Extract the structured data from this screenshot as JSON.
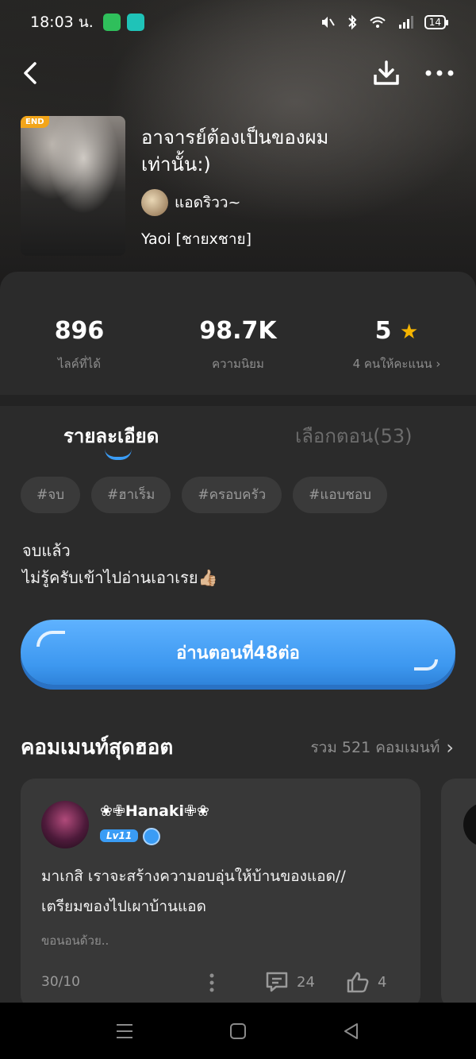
{
  "status_bar": {
    "time": "18:03 น.",
    "battery": "14"
  },
  "book": {
    "end_badge": "END",
    "title": "อาจารย์ต้องเป็นของผมเท่านั้น:)",
    "author": "แอดริวว~",
    "genre": "Yaoi [ชายxชาย]"
  },
  "stats": {
    "likes_value": "896",
    "likes_label": "ไลค์ที่ได้",
    "popularity_value": "98.7K",
    "popularity_label": "ความนิยม",
    "rating_value": "5",
    "rating_label": "4 คนให้คะแนน"
  },
  "tabs": {
    "details": "รายละเอียด",
    "episodes": "เลือกตอน(53)"
  },
  "tags": [
    "#จบ",
    "#ฮาเร็ม",
    "#ครอบครัว",
    "#แอบชอบ"
  ],
  "description": {
    "line1": "จบแล้ว",
    "line2": "ไม่รู้ครับเข้าไปอ่านเอาเรย👍🏼"
  },
  "read_button": "อ่านตอนที่48ต่อ",
  "hot_comments": {
    "title": "คอมเมนท์สุดฮอต",
    "total": "รวม 521 คอมเมนท์"
  },
  "comment": {
    "username": "❀✙Hanaki✙❀",
    "level": "Lv11",
    "text": "มาเกสิ เราจะสร้างความอบอุ่นให้บ้านของแอด//เตรียมของไปเผาบ้านแอด",
    "reply_preview": "ขอนอนด้วย..",
    "date": "30/10",
    "comment_count": "24",
    "like_count": "4"
  },
  "colors": {
    "accent": "#3a9cf5",
    "star": "#f5b400",
    "end_badge": "#f2a51a",
    "sheet_bg": "#2b2b2b",
    "card_bg": "#383838"
  }
}
